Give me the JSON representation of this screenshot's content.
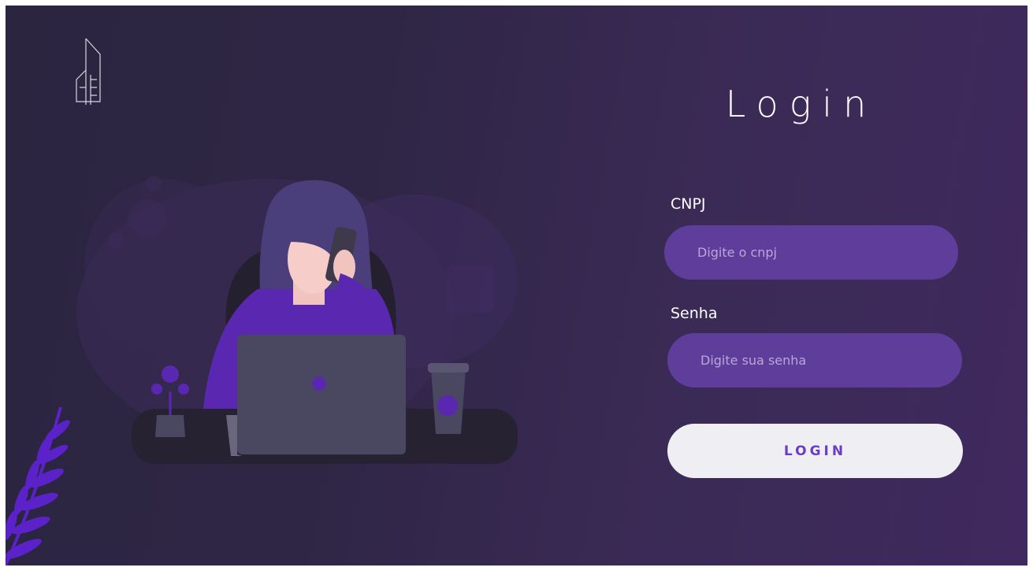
{
  "login_form": {
    "title": "Login",
    "cnpj_label": "CNPJ",
    "cnpj_placeholder": "Digite o cnpj",
    "password_label": "Senha",
    "password_placeholder": "Digite sua senha",
    "submit_label": "LOGIN"
  },
  "colors": {
    "background_dark": "#2b2540",
    "background_purple": "#40295e",
    "input_fill": "#5f3d9b",
    "button_fill": "#efeef3",
    "button_text": "#6a3ec4"
  },
  "icons": {
    "logo": "building-logo-icon",
    "illustration": "woman-on-phone-with-laptop-illustration",
    "plant": "leaf-branch-icon"
  }
}
